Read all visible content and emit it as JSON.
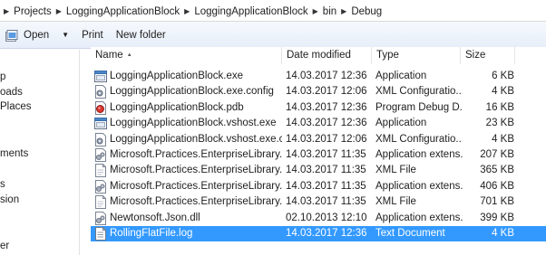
{
  "address": {
    "crumbs": [
      "Projects",
      "LoggingApplicationBlock",
      "LoggingApplicationBlock",
      "bin",
      "Debug"
    ]
  },
  "toolbar": {
    "open_label": "Open",
    "print_label": "Print",
    "new_folder_label": "New folder"
  },
  "nav": {
    "items": [
      "p",
      "oads",
      " Places",
      "ments",
      "s",
      "sion",
      "er"
    ]
  },
  "columns": {
    "name": "Name",
    "date": "Date modified",
    "type": "Type",
    "size": "Size"
  },
  "files": [
    {
      "name": "LoggingApplicationBlock.exe",
      "date": "14.03.2017 12:36",
      "type": "Application",
      "size": "6 KB",
      "icon": "exe-icon"
    },
    {
      "name": "LoggingApplicationBlock.exe.config",
      "date": "14.03.2017 12:06",
      "type": "XML Configuratio...",
      "size": "4 KB",
      "icon": "config-icon"
    },
    {
      "name": "LoggingApplicationBlock.pdb",
      "date": "14.03.2017 12:36",
      "type": "Program Debug D...",
      "size": "16 KB",
      "icon": "pdb-icon"
    },
    {
      "name": "LoggingApplicationBlock.vshost.exe",
      "date": "14.03.2017 12:36",
      "type": "Application",
      "size": "23 KB",
      "icon": "exe-icon"
    },
    {
      "name": "LoggingApplicationBlock.vshost.exe.con...",
      "date": "14.03.2017 12:06",
      "type": "XML Configuratio...",
      "size": "4 KB",
      "icon": "config-icon"
    },
    {
      "name": "Microsoft.Practices.EnterpriseLibrary.Co...",
      "date": "14.03.2017 11:35",
      "type": "Application extens...",
      "size": "207 KB",
      "icon": "dll-icon"
    },
    {
      "name": "Microsoft.Practices.EnterpriseLibrary.Co...",
      "date": "14.03.2017 11:35",
      "type": "XML File",
      "size": "365 KB",
      "icon": "xml-icon"
    },
    {
      "name": "Microsoft.Practices.EnterpriseLibrary.Log...",
      "date": "14.03.2017 11:35",
      "type": "Application extens...",
      "size": "406 KB",
      "icon": "dll-icon"
    },
    {
      "name": "Microsoft.Practices.EnterpriseLibrary.Log...",
      "date": "14.03.2017 11:35",
      "type": "XML File",
      "size": "701 KB",
      "icon": "xml-icon"
    },
    {
      "name": "Newtonsoft.Json.dll",
      "date": "02.10.2013 12:10",
      "type": "Application extens...",
      "size": "399 KB",
      "icon": "dll-icon"
    },
    {
      "name": "RollingFlatFile.log",
      "date": "14.03.2017 12:36",
      "type": "Text Document",
      "size": "4 KB",
      "icon": "text-file-icon",
      "selected": true
    }
  ],
  "colors": {
    "selection": "#3399ff",
    "toolbar_top": "#f6f9fd",
    "toolbar_bottom": "#e6eef9"
  }
}
